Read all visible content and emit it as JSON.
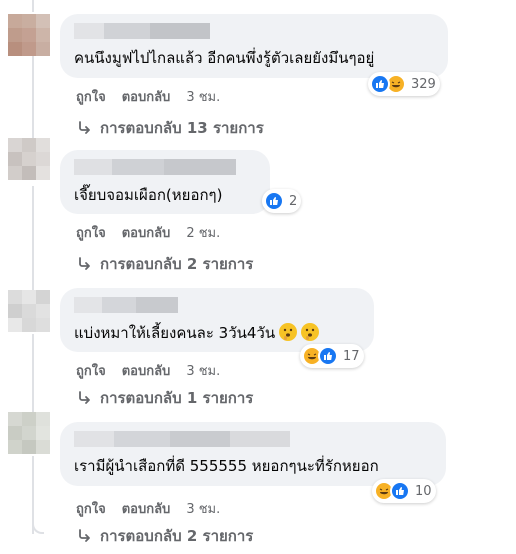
{
  "comments": [
    {
      "text": "คนนึงมูฟไปไกลแล้ว อีกคนพึ่งรู้ตัวเลยยังมึนๆอยู่",
      "reactions": {
        "icons": [
          "like-icon",
          "haha-icon"
        ],
        "count": "329"
      },
      "like_label": "ถูกใจ",
      "reply_label": "ตอบกลับ",
      "time": "3 ชม.",
      "replies_label": "การตอบกลับ 13 รายการ"
    },
    {
      "text": "เจี๊ยบจอมเผือก(หยอกๆ)",
      "reactions": {
        "icons": [
          "like-icon"
        ],
        "count": "2"
      },
      "like_label": "ถูกใจ",
      "reply_label": "ตอบกลับ",
      "time": "2 ชม.",
      "replies_label": "การตอบกลับ 2 รายการ"
    },
    {
      "text": "แบ่งหมาให้เลี้ยงคนละ 3วัน4วัน",
      "emojis": [
        "shushing-face-icon",
        "shushing-face-icon"
      ],
      "reactions": {
        "icons": [
          "haha-icon",
          "like-icon"
        ],
        "count": "17"
      },
      "like_label": "ถูกใจ",
      "reply_label": "ตอบกลับ",
      "time": "3 ชม.",
      "replies_label": "การตอบกลับ 1 รายการ"
    },
    {
      "text": "เรามีผู้นำเสือกที่ดี 555555 หยอกๆนะที่รักหยอก",
      "reactions": {
        "icons": [
          "haha-icon",
          "like-icon"
        ],
        "count": "10"
      },
      "like_label": "ถูกใจ",
      "reply_label": "ตอบกลับ",
      "time": "3 ชม.",
      "replies_label": "การตอบกลับ 2 รายการ"
    }
  ],
  "colors": {
    "bubble": "#f0f2f5",
    "secondary_text": "#65676b",
    "like_blue": "#1877f2",
    "haha_yellow": "#f7b125"
  }
}
